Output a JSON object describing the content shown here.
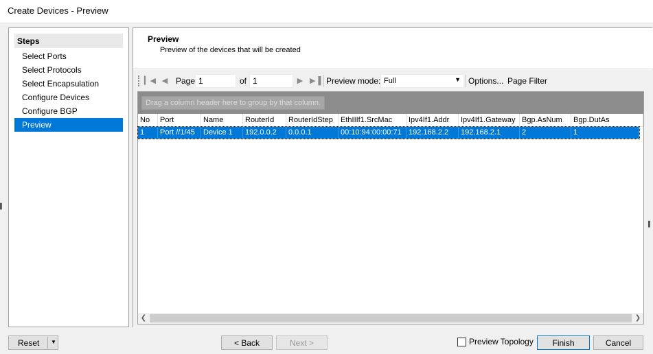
{
  "window": {
    "title": "Create Devices - Preview"
  },
  "steps": {
    "header": "Steps",
    "items": [
      {
        "label": "Select Ports"
      },
      {
        "label": "Select Protocols"
      },
      {
        "label": "Select Encapsulation"
      },
      {
        "label": "Configure Devices"
      },
      {
        "label": "Configure BGP"
      },
      {
        "label": "Preview",
        "selected": true
      }
    ]
  },
  "main": {
    "title": "Preview",
    "subtitle": "Preview of the devices that will be created"
  },
  "toolbar": {
    "page_label": "Page",
    "page_value": "1",
    "of_label": "of",
    "of_value": "1",
    "preview_mode_label": "Preview mode:",
    "preview_mode_value": "Full",
    "options_label": "Options...",
    "page_filter_label": "Page Filter"
  },
  "grid": {
    "group_hint": "Drag a column header here to group by that column.",
    "columns": [
      "No",
      "Port",
      "Name",
      "RouterId",
      "RouterIdStep",
      "EthIIIf1.SrcMac",
      "Ipv4If1.Addr",
      "Ipv4If1.Gateway",
      "Bgp.AsNum",
      "Bgp.DutAs"
    ],
    "rows": [
      [
        "1",
        "Port //1/45",
        "Device 1",
        "192.0.0.2",
        "0.0.0.1",
        "00:10:94:00:00:71",
        "192.168.2.2",
        "192.168.2.1",
        "2",
        "1"
      ]
    ]
  },
  "footer": {
    "reset_label": "Reset",
    "back_label": "< Back",
    "next_label": "Next >",
    "preview_topology_label": "Preview Topology",
    "finish_label": "Finish",
    "cancel_label": "Cancel"
  }
}
